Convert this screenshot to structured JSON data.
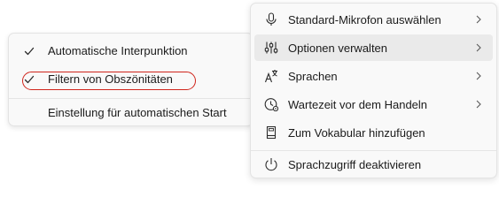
{
  "submenu": {
    "items": [
      {
        "label": "Automatische Interpunktion",
        "checked": true
      },
      {
        "label": "Filtern von Obszönitäten",
        "checked": true
      },
      {
        "label": "Einstellung für automatischen Start",
        "checked": false
      }
    ]
  },
  "mainmenu": {
    "items": [
      {
        "label": "Standard-Mikrofon auswählen",
        "icon": "microphone-icon",
        "has_submenu": true
      },
      {
        "label": "Optionen verwalten",
        "icon": "options-icon",
        "has_submenu": true,
        "hovered": true
      },
      {
        "label": "Sprachen",
        "icon": "language-icon",
        "has_submenu": true
      },
      {
        "label": "Wartezeit vor dem Handeln",
        "icon": "timer-icon",
        "has_submenu": true
      },
      {
        "label": "Zum Vokabular hinzufügen",
        "icon": "vocabulary-icon",
        "has_submenu": false
      },
      {
        "label": "Sprachzugriff deaktivieren",
        "icon": "power-icon",
        "has_submenu": false
      }
    ]
  },
  "colors": {
    "menu_background": "#f9f9f9",
    "hover_background": "#eaeaea",
    "highlight_ring": "#d0241b",
    "text": "#1b1b1b"
  }
}
